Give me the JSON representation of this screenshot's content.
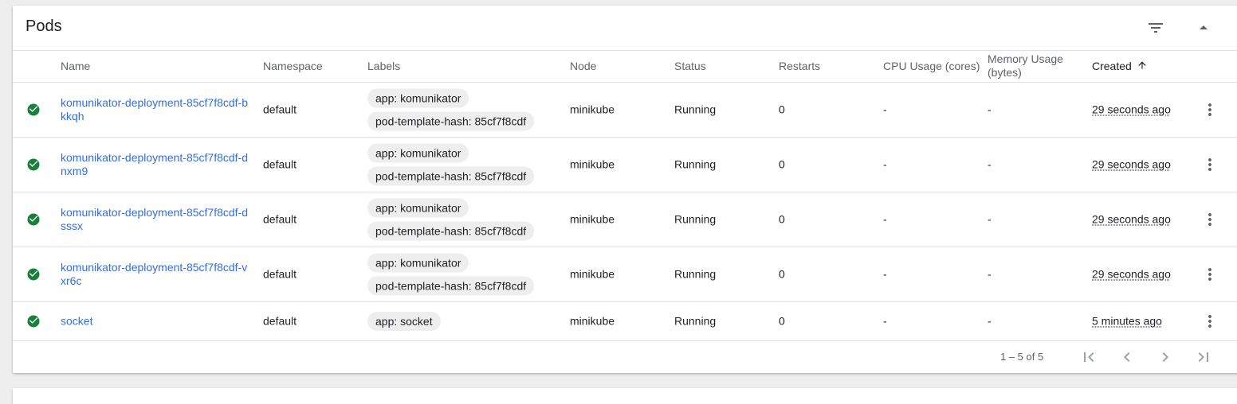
{
  "card": {
    "title": "Pods"
  },
  "header": {
    "filter_icon": "filter-list-icon",
    "collapse_icon": "arrow-drop-up-icon"
  },
  "columns": {
    "name": "Name",
    "namespace": "Namespace",
    "labels": "Labels",
    "node": "Node",
    "status": "Status",
    "restarts": "Restarts",
    "cpu": "CPU Usage (cores)",
    "memory_line1": "Memory Usage",
    "memory_line2": "(bytes)",
    "created": "Created",
    "created_sort": "ascending"
  },
  "pods": [
    {
      "name": "komunikator-deployment-85cf7f8cdf-bkkqh",
      "namespace": "default",
      "labels": [
        "app: komunikator",
        "pod-template-hash: 85cf7f8cdf"
      ],
      "node": "minikube",
      "status": "Running",
      "restarts": "0",
      "cpu": "-",
      "memory": "-",
      "created": "29 seconds ago",
      "status_icon": "check-circle-icon"
    },
    {
      "name": "komunikator-deployment-85cf7f8cdf-dnxm9",
      "namespace": "default",
      "labels": [
        "app: komunikator",
        "pod-template-hash: 85cf7f8cdf"
      ],
      "node": "minikube",
      "status": "Running",
      "restarts": "0",
      "cpu": "-",
      "memory": "-",
      "created": "29 seconds ago",
      "status_icon": "check-circle-icon"
    },
    {
      "name": "komunikator-deployment-85cf7f8cdf-dsssx",
      "namespace": "default",
      "labels": [
        "app: komunikator",
        "pod-template-hash: 85cf7f8cdf"
      ],
      "node": "minikube",
      "status": "Running",
      "restarts": "0",
      "cpu": "-",
      "memory": "-",
      "created": "29 seconds ago",
      "status_icon": "check-circle-icon"
    },
    {
      "name": "komunikator-deployment-85cf7f8cdf-vxr6c",
      "namespace": "default",
      "labels": [
        "app: komunikator",
        "pod-template-hash: 85cf7f8cdf"
      ],
      "node": "minikube",
      "status": "Running",
      "restarts": "0",
      "cpu": "-",
      "memory": "-",
      "created": "29 seconds ago",
      "status_icon": "check-circle-icon"
    },
    {
      "name": "socket",
      "namespace": "default",
      "labels": [
        "app: socket"
      ],
      "node": "minikube",
      "status": "Running",
      "restarts": "0",
      "cpu": "-",
      "memory": "-",
      "created": "5 minutes ago",
      "status_icon": "check-circle-icon"
    }
  ],
  "paginator": {
    "range_label": "1 – 5 of 5",
    "first_icon": "first-page-icon",
    "prev_icon": "chevron-left-icon",
    "next_icon": "chevron-right-icon",
    "last_icon": "last-page-icon"
  },
  "colors": {
    "link": "#326de6",
    "status_ok": "#188038",
    "divider": "#e0e0e0",
    "chip_bg": "#eeeeee"
  }
}
